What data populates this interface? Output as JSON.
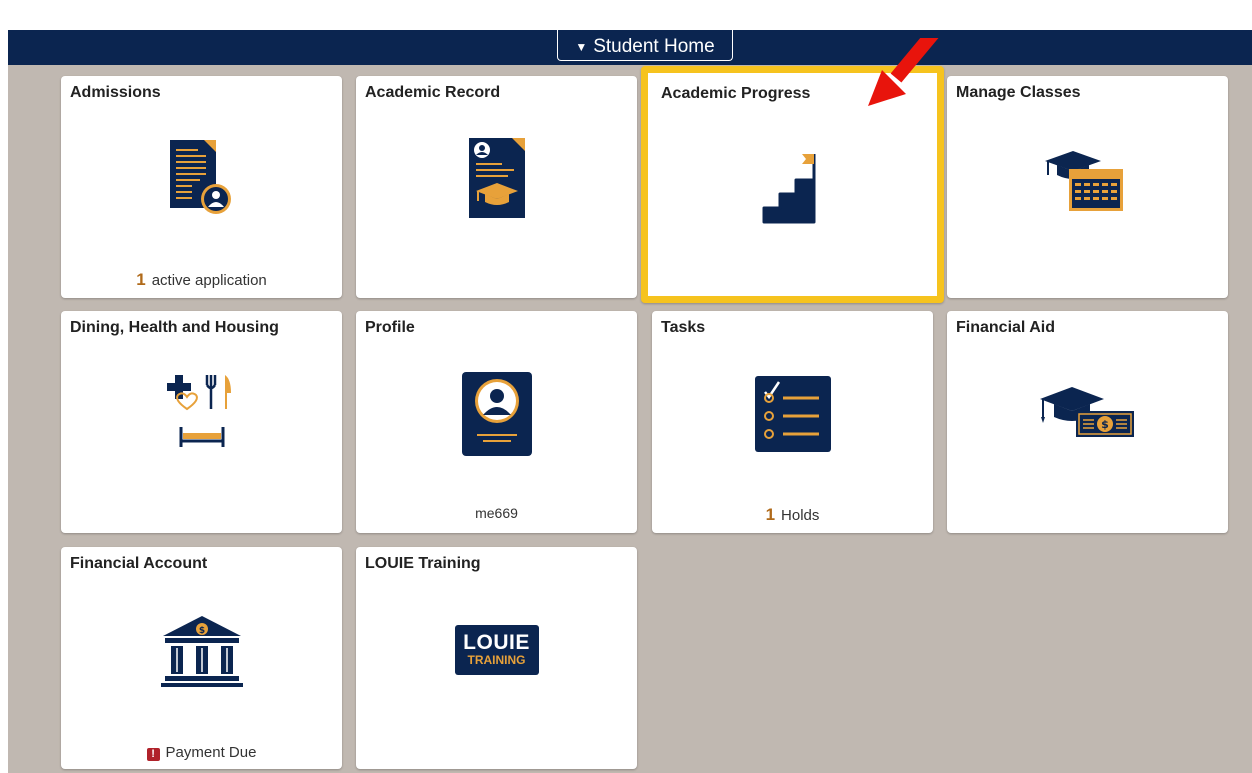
{
  "navbar": {
    "home_label": "Student Home",
    "caret_icon": "triangle-down-icon"
  },
  "colors": {
    "navy": "#0b2550",
    "gold": "#f6c31e",
    "orange": "#e7a13a",
    "page_bg": "#c0b8b1",
    "arrow": "#e8140c"
  },
  "tiles": {
    "admissions": {
      "title": "Admissions",
      "count": "1",
      "note": "active application",
      "icon": "admissions-document-icon"
    },
    "academic_record": {
      "title": "Academic Record",
      "icon": "diploma-record-icon"
    },
    "academic_progress": {
      "title": "Academic Progress",
      "icon": "stairs-flag-icon"
    },
    "manage_classes": {
      "title": "Manage Classes",
      "icon": "graduation-calendar-icon"
    },
    "dining": {
      "title": "Dining, Health and Housing",
      "icon": "dining-health-housing-icon"
    },
    "profile": {
      "title": "Profile",
      "note": "me669",
      "icon": "profile-badge-icon"
    },
    "tasks": {
      "title": "Tasks",
      "count": "1",
      "note": "Holds",
      "icon": "checklist-icon"
    },
    "financial_aid": {
      "title": "Financial Aid",
      "icon": "cap-money-icon"
    },
    "financial_account": {
      "title": "Financial Account",
      "alert": "!",
      "note": "Payment Due",
      "icon": "bank-icon"
    },
    "louie_training": {
      "title": "LOUIE Training",
      "logo_top": "LOUIE",
      "logo_bottom": "TRAINING",
      "icon": "louie-training-logo"
    }
  }
}
